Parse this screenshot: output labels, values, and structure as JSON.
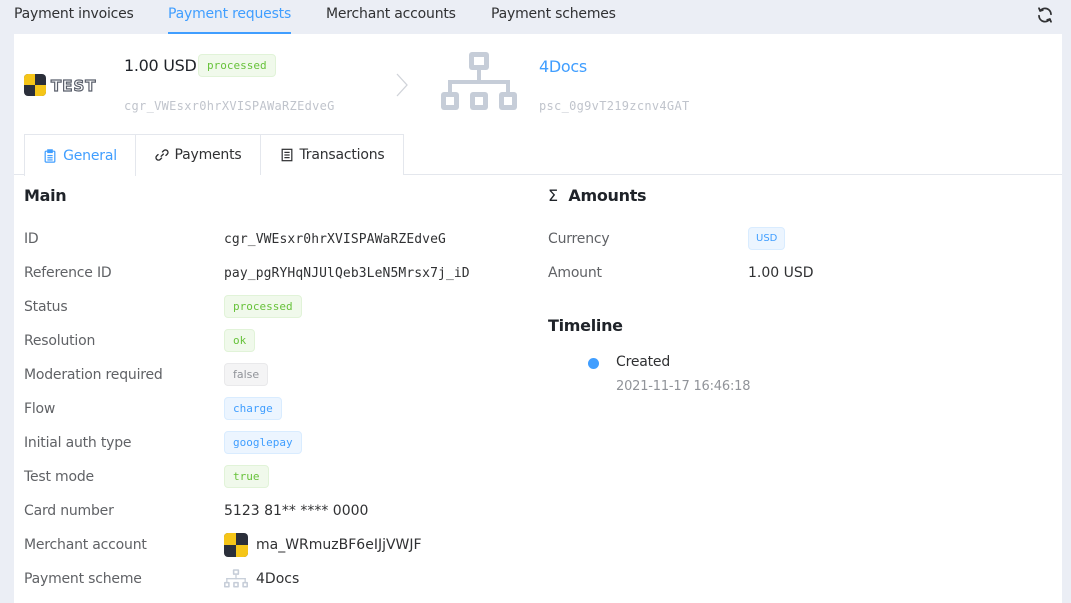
{
  "nav": {
    "tabs": [
      {
        "label": "Payment invoices",
        "active": false
      },
      {
        "label": "Payment requests",
        "active": true
      },
      {
        "label": "Merchant accounts",
        "active": false
      },
      {
        "label": "Payment schemes",
        "active": false
      }
    ],
    "refresh_icon": "refresh-icon"
  },
  "header": {
    "logo_text": "TEST",
    "amount": "1.00 USD",
    "status": "processed",
    "request_id": "cgr_VWEsxr0hrXVISPAWaRZEdveG",
    "scheme_name": "4Docs",
    "scheme_id": "psc_0g9vT219zcnv4GAT"
  },
  "tabs": [
    {
      "label": "General",
      "icon": "clipboard-icon",
      "active": true
    },
    {
      "label": "Payments",
      "icon": "link-icon",
      "active": false
    },
    {
      "label": "Transactions",
      "icon": "receipt-icon",
      "active": false
    }
  ],
  "main": {
    "title": "Main",
    "rows": [
      {
        "label": "ID",
        "value": "cgr_VWEsxr0hrXVISPAWaRZEdveG"
      },
      {
        "label": "Reference ID",
        "value": "pay_pgRYHqNJUlQeb3LeN5Mrsx7j_iD"
      },
      {
        "label": "Status",
        "value": "processed"
      },
      {
        "label": "Resolution",
        "value": "ok"
      },
      {
        "label": "Moderation required",
        "value": "false"
      },
      {
        "label": "Flow",
        "value": "charge"
      },
      {
        "label": "Initial auth type",
        "value": "googlepay"
      },
      {
        "label": "Test mode",
        "value": "true"
      },
      {
        "label": "Card number",
        "value": "5123 81** **** 0000"
      },
      {
        "label": "Merchant account",
        "value": "ma_WRmuzBF6eIJjVWJF"
      },
      {
        "label": "Payment scheme",
        "value": "4Docs"
      }
    ]
  },
  "amounts": {
    "icon": "Σ",
    "title": "Amounts",
    "rows": [
      {
        "label": "Currency",
        "value": "USD"
      },
      {
        "label": "Amount",
        "value": "1.00 USD"
      }
    ]
  },
  "timeline": {
    "title": "Timeline",
    "events": [
      {
        "title": "Created",
        "time": "2021-11-17 16:46:18"
      }
    ]
  },
  "colors": {
    "accent": "#409eff",
    "success": "#67c23a",
    "muted": "#909399",
    "brand_yellow": "#f5c518",
    "brand_dark": "#2b2f3a"
  }
}
